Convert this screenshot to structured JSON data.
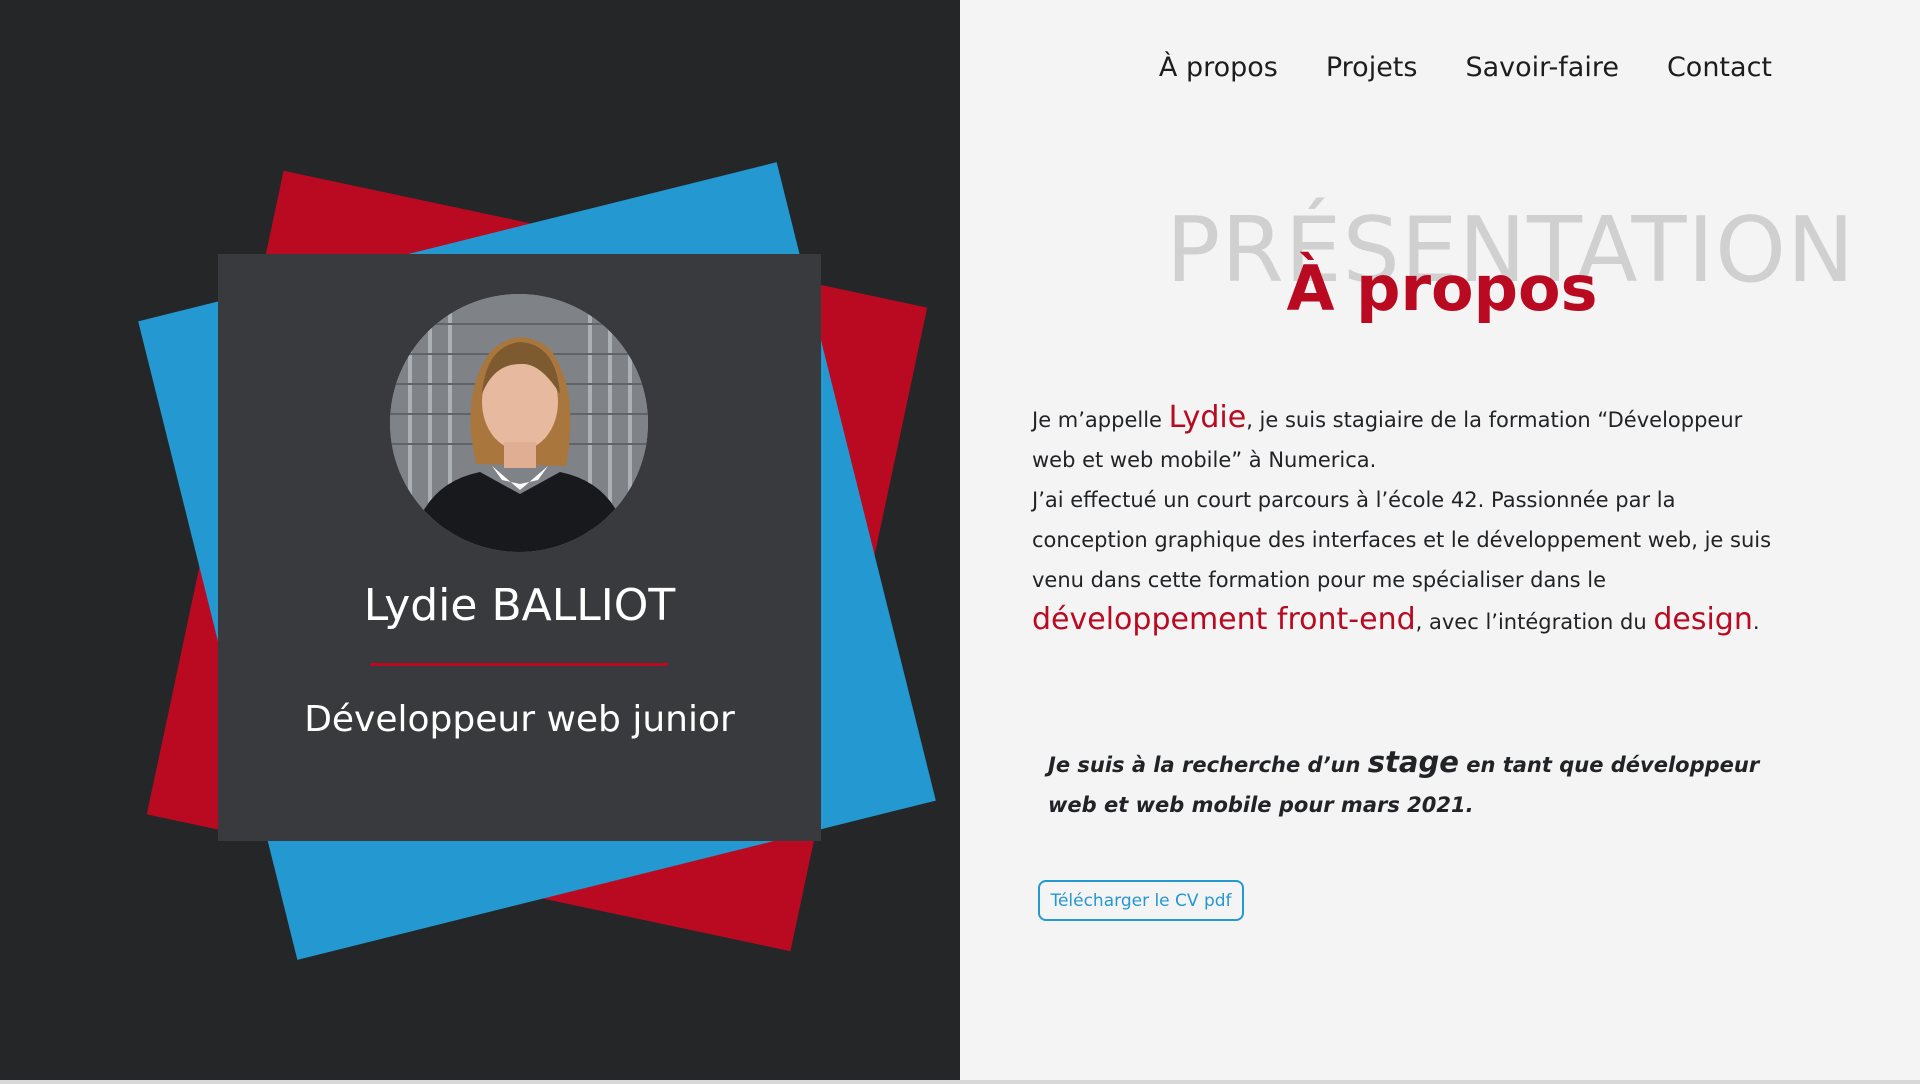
{
  "nav": {
    "items": [
      {
        "label": "À propos"
      },
      {
        "label": "Projets"
      },
      {
        "label": "Savoir-faire"
      },
      {
        "label": "Contact"
      }
    ]
  },
  "profile": {
    "name": "Lydie BALLIOT",
    "role": "Développeur web junior"
  },
  "section": {
    "background_title": "PRÉSENTATION",
    "title": "À propos"
  },
  "about": {
    "p1_a": "Je m’appelle ",
    "p1_name": "Lydie",
    "p1_b": ", je suis stagiaire de la formation “Développeur web et web mobile” à Numerica.",
    "p2_a": "J’ai effectué un court parcours à l’école 42. Passionnée par la conception graphique des interfaces et le développement web, je suis venu dans cette formation pour me spécialiser dans le ",
    "p2_highlight1": "développement front-end",
    "p2_b": ", avec l’intégration du ",
    "p2_highlight2": "design",
    "p2_c": "."
  },
  "callout": {
    "a": "Je suis à la recherche d’un ",
    "highlight": "stage",
    "b": " en tant que développeur web et web mobile pour mars 2021."
  },
  "cv_button": {
    "label": "Télécharger le CV pdf"
  },
  "colors": {
    "accent_red": "#b90a22",
    "accent_blue": "#2498d1",
    "dark_bg": "#252628",
    "card_bg": "#393a3d",
    "page_bg": "#f3f4f3"
  }
}
